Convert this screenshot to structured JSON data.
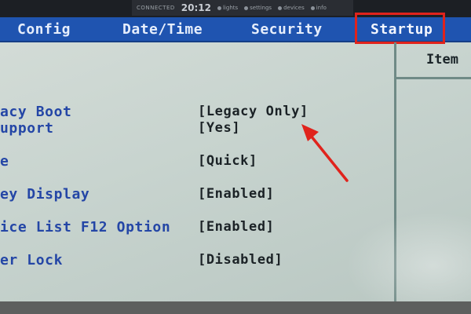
{
  "overlay": {
    "left_text": "CONNECTED",
    "clock": "20:12",
    "items": [
      "lights",
      "settings",
      "devices",
      "info"
    ]
  },
  "menu": {
    "tabs": [
      {
        "label": "Config"
      },
      {
        "label": "Date/Time"
      },
      {
        "label": "Security"
      },
      {
        "label": "Startup",
        "active": true
      }
    ]
  },
  "help_panel": {
    "title": "Item"
  },
  "settings": [
    {
      "label": "acy Boot",
      "value": "[Legacy Only]"
    },
    {
      "label": "upport",
      "value": "[Yes]"
    },
    {
      "label": "e",
      "value": "[Quick]"
    },
    {
      "label": "ey Display",
      "value": "[Enabled]"
    },
    {
      "label": "ice List F12 Option",
      "value": "[Enabled]"
    },
    {
      "label": "er Lock",
      "value": "[Disabled]"
    }
  ],
  "colors": {
    "menu_bar": "#1f54b0",
    "screen_bg": "#c8d4cf",
    "label_text": "#2446a6",
    "value_text": "#1b2226",
    "annotation": "#e0231c"
  }
}
